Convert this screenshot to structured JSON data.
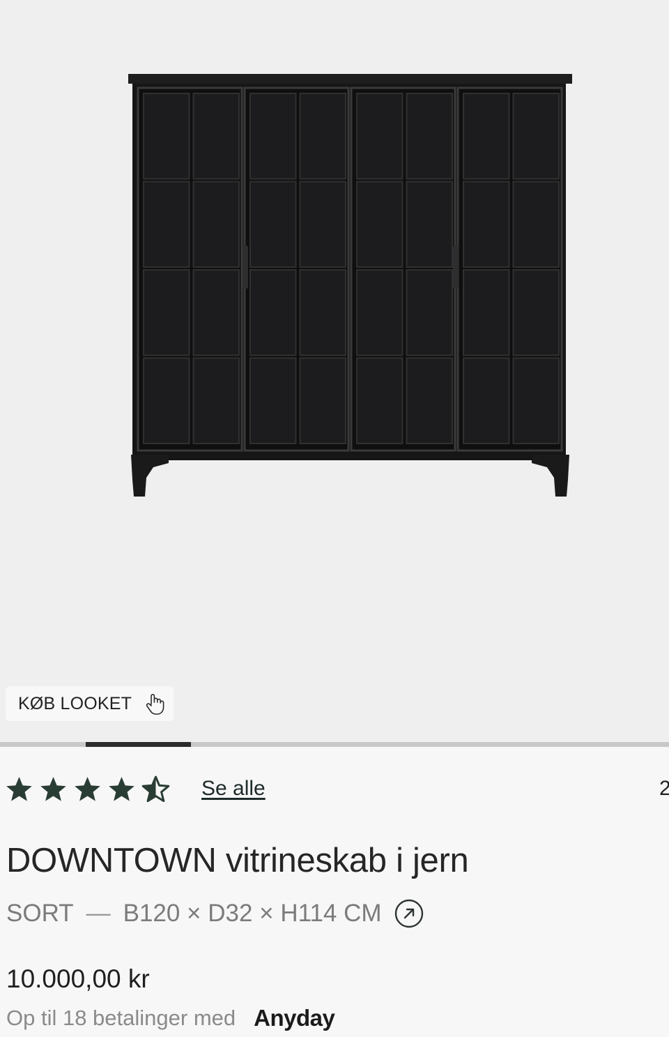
{
  "gallery": {
    "shop_look_label": "KØB LOOKET",
    "active_slide_fraction": 0.157
  },
  "rating": {
    "value": 4.5,
    "max": 5,
    "see_all_label": "Se alle",
    "count_partial": "2"
  },
  "product": {
    "title": "DOWNTOWN vitrineskab i jern",
    "color": "SORT",
    "separator": "—",
    "dimensions": "B120 × D32 × H114 CM",
    "price": "10.000,00 kr"
  },
  "financing": {
    "text": "Op til 18 betalinger med",
    "provider": "Anyday"
  },
  "colors": {
    "star": "#2a3d34",
    "background": "#f7f7f7",
    "gallery_bg": "#efefef",
    "progress_active": "#2b2b2b"
  }
}
